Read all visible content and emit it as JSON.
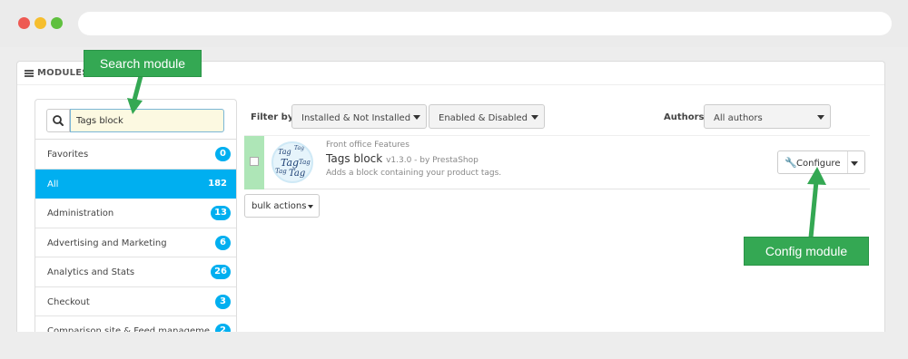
{
  "browser": {
    "dots": [
      "#ee5a53",
      "#f6be2e",
      "#5fc03e"
    ]
  },
  "panel": {
    "title": "MODULES L"
  },
  "search": {
    "value": "Tags block"
  },
  "categories": [
    {
      "label": "Favorites",
      "count": "0"
    },
    {
      "label": "All",
      "count": "182",
      "active": true
    },
    {
      "label": "Administration",
      "count": "13"
    },
    {
      "label": "Advertising and Marketing",
      "count": "6"
    },
    {
      "label": "Analytics and Stats",
      "count": "26"
    },
    {
      "label": "Checkout",
      "count": "3"
    },
    {
      "label": "Comparison site & Feed manageme...",
      "count": "2"
    }
  ],
  "filters": {
    "filter_by_label": "Filter by",
    "install_select": "Installed & Not Installed",
    "enabled_select": "Enabled & Disabled",
    "authors_label": "Authors",
    "authors_select": "All authors"
  },
  "module": {
    "category": "Front office Features",
    "name": "Tags block",
    "version": "v1.3.0 - by PrestaShop",
    "description": "Adds a block containing your product tags.",
    "configure_label": "Configure"
  },
  "bulk_actions_label": "bulk actions",
  "annotations": {
    "search_callout": "Search module",
    "config_callout": "Config module",
    "color": "#34a853"
  }
}
